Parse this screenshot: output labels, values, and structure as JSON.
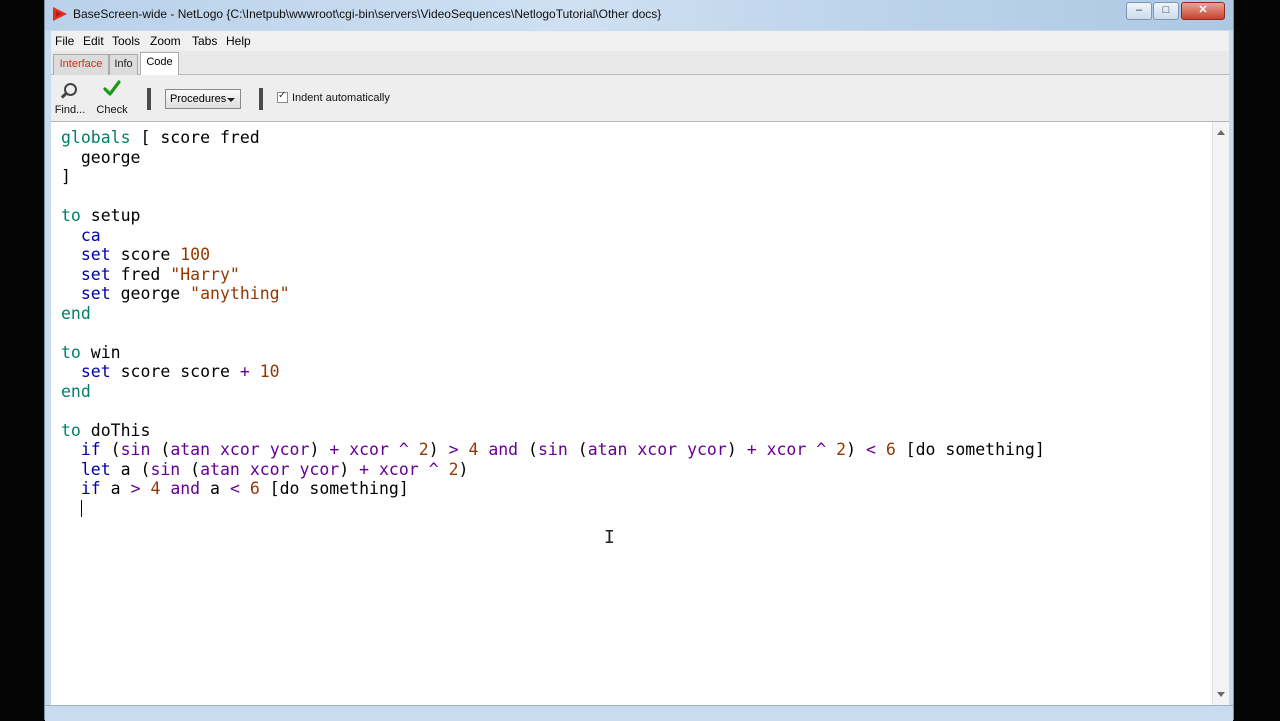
{
  "window": {
    "title": "BaseScreen-wide - NetLogo {C:\\Inetpub\\wwwroot\\cgi-bin\\servers\\VideoSequences\\NetlogoTutorial\\Other docs}",
    "minimize": "–",
    "maximize": "□",
    "close": "✕"
  },
  "menu": [
    "File",
    "Edit",
    "Tools",
    "Zoom",
    "Tabs",
    "Help"
  ],
  "tabs": [
    "Interface",
    "Info",
    "Code"
  ],
  "toolbar": {
    "find_label": "Find...",
    "check_label": "Check",
    "procedures_label": "Procedures",
    "indent_label": "Indent automatically",
    "indent_checked": true
  },
  "code_lines": [
    [
      [
        "kw",
        "globals"
      ],
      [
        "t",
        " [ score fred"
      ]
    ],
    [
      [
        "t",
        "  george"
      ]
    ],
    [
      [
        "t",
        "]"
      ]
    ],
    [],
    [
      [
        "kw",
        "to"
      ],
      [
        "t",
        " setup"
      ]
    ],
    [
      [
        "t",
        "  "
      ],
      [
        "cmd",
        "ca"
      ]
    ],
    [
      [
        "t",
        "  "
      ],
      [
        "cmd",
        "set"
      ],
      [
        "t",
        " score "
      ],
      [
        "num",
        "100"
      ]
    ],
    [
      [
        "t",
        "  "
      ],
      [
        "cmd",
        "set"
      ],
      [
        "t",
        " fred "
      ],
      [
        "str",
        "\"Harry\""
      ]
    ],
    [
      [
        "t",
        "  "
      ],
      [
        "cmd",
        "set"
      ],
      [
        "t",
        " george "
      ],
      [
        "str",
        "\"anything\""
      ]
    ],
    [
      [
        "kw",
        "end"
      ]
    ],
    [],
    [
      [
        "kw",
        "to"
      ],
      [
        "t",
        " win"
      ]
    ],
    [
      [
        "t",
        "  "
      ],
      [
        "cmd",
        "set"
      ],
      [
        "t",
        " score score "
      ],
      [
        "op",
        "+"
      ],
      [
        "t",
        " "
      ],
      [
        "num",
        "10"
      ]
    ],
    [
      [
        "kw",
        "end"
      ]
    ],
    [],
    [
      [
        "kw",
        "to"
      ],
      [
        "t",
        " doThis"
      ]
    ],
    [
      [
        "t",
        "  "
      ],
      [
        "cmd",
        "if"
      ],
      [
        "t",
        " ("
      ],
      [
        "rep",
        "sin"
      ],
      [
        "t",
        " ("
      ],
      [
        "rep",
        "atan"
      ],
      [
        "t",
        " "
      ],
      [
        "rep",
        "xcor"
      ],
      [
        "t",
        " "
      ],
      [
        "rep",
        "ycor"
      ],
      [
        "t",
        ") "
      ],
      [
        "op",
        "+"
      ],
      [
        "t",
        " "
      ],
      [
        "rep",
        "xcor"
      ],
      [
        "t",
        " "
      ],
      [
        "op",
        "^"
      ],
      [
        "t",
        " "
      ],
      [
        "num",
        "2"
      ],
      [
        "t",
        ") "
      ],
      [
        "op",
        ">"
      ],
      [
        "t",
        " "
      ],
      [
        "num",
        "4"
      ],
      [
        "t",
        " "
      ],
      [
        "op",
        "and"
      ],
      [
        "t",
        " ("
      ],
      [
        "rep",
        "sin"
      ],
      [
        "t",
        " ("
      ],
      [
        "rep",
        "atan"
      ],
      [
        "t",
        " "
      ],
      [
        "rep",
        "xcor"
      ],
      [
        "t",
        " "
      ],
      [
        "rep",
        "ycor"
      ],
      [
        "t",
        ") "
      ],
      [
        "op",
        "+"
      ],
      [
        "t",
        " "
      ],
      [
        "rep",
        "xcor"
      ],
      [
        "t",
        " "
      ],
      [
        "op",
        "^"
      ],
      [
        "t",
        " "
      ],
      [
        "num",
        "2"
      ],
      [
        "t",
        ") "
      ],
      [
        "op",
        "<"
      ],
      [
        "t",
        " "
      ],
      [
        "num",
        "6"
      ],
      [
        "t",
        " [do something]"
      ]
    ],
    [
      [
        "t",
        "  "
      ],
      [
        "cmd",
        "let"
      ],
      [
        "t",
        " a ("
      ],
      [
        "rep",
        "sin"
      ],
      [
        "t",
        " ("
      ],
      [
        "rep",
        "atan"
      ],
      [
        "t",
        " "
      ],
      [
        "rep",
        "xcor"
      ],
      [
        "t",
        " "
      ],
      [
        "rep",
        "ycor"
      ],
      [
        "t",
        ") "
      ],
      [
        "op",
        "+"
      ],
      [
        "t",
        " "
      ],
      [
        "rep",
        "xcor"
      ],
      [
        "t",
        " "
      ],
      [
        "op",
        "^"
      ],
      [
        "t",
        " "
      ],
      [
        "num",
        "2"
      ],
      [
        "t",
        ")"
      ]
    ],
    [
      [
        "t",
        "  "
      ],
      [
        "cmd",
        "if"
      ],
      [
        "t",
        " a "
      ],
      [
        "op",
        ">"
      ],
      [
        "t",
        " "
      ],
      [
        "num",
        "4"
      ],
      [
        "t",
        " "
      ],
      [
        "op",
        "and"
      ],
      [
        "t",
        " a "
      ],
      [
        "op",
        "<"
      ],
      [
        "t",
        " "
      ],
      [
        "num",
        "6"
      ],
      [
        "t",
        " [do something]"
      ]
    ],
    [
      [
        "t",
        "  "
      ],
      [
        "caret",
        ""
      ]
    ]
  ]
}
